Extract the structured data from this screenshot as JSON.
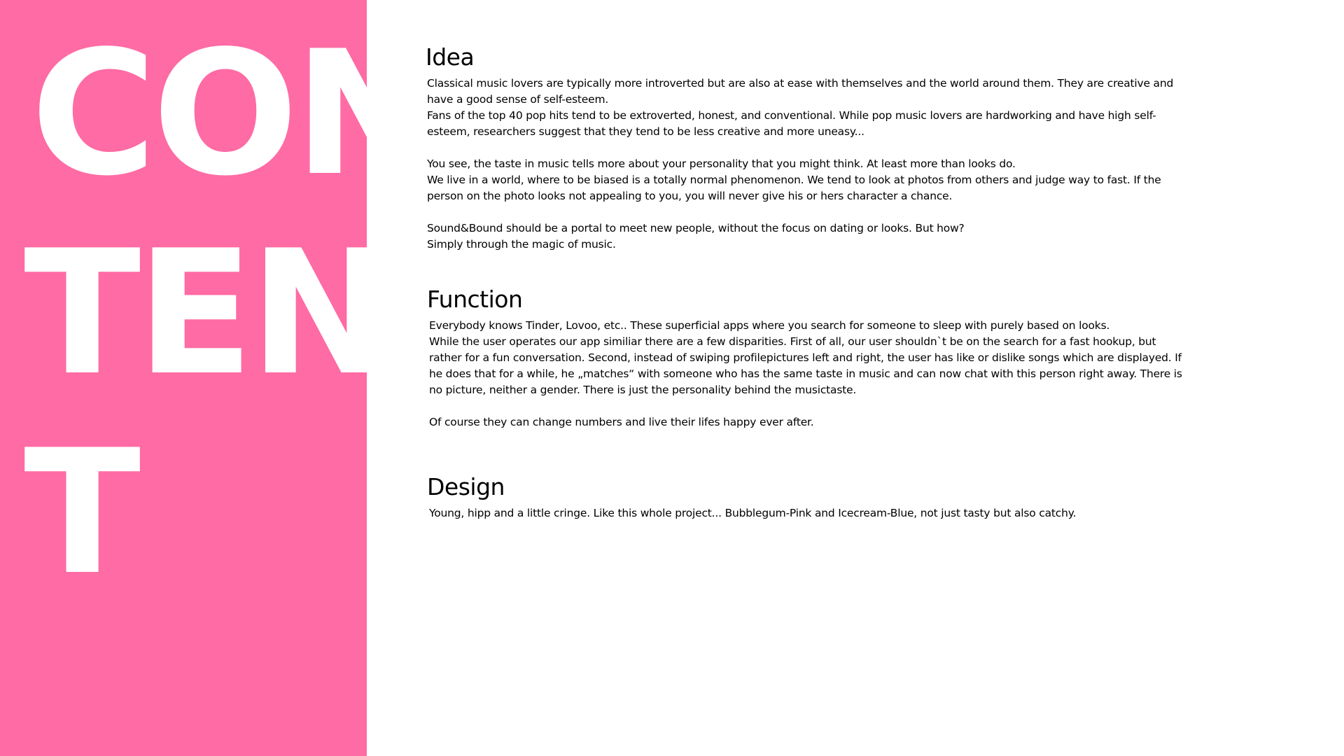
{
  "sidebar": {
    "title_lines": [
      "CON",
      "TEN",
      "T"
    ]
  },
  "sections": {
    "idea": {
      "heading": "Idea",
      "paragraphs": [
        "Classical music lovers are typically more introverted but are also at ease with themselves and the world around them. They are creative and have a good sense of self-esteem.",
        "Fans of the top 40 pop hits tend to be extroverted, honest, and conventional. While pop music lovers are hardworking and have high self-esteem, researchers suggest that they tend to be less creative and more uneasy...",
        "You see, the taste in music tells more about your personality that you might think. At least more than looks do.",
        "We live in a world, where to be biased is a totally normal phenomenon. We tend to look at photos from others and judge way to fast. If the person on the photo looks not appealing to you, you will never give his or hers character a chance.",
        "Sound&Bound should be a portal to meet new people, without the focus on dating or looks. But how?",
        "Simply through the magic of music."
      ]
    },
    "function": {
      "heading": "Function",
      "paragraphs": [
        "Everybody knows Tinder, Lovoo, etc.. These superficial apps where you search for someone to sleep with purely based on looks.",
        "While the user operates our app similiar there are a few disparities. First of all, our user shouldn`t be on the search for a fast hookup, but rather for a fun conversation. Second, instead of swiping profilepictures left and right, the user has like or dislike songs which are displayed. If he does that for a while, he „matches“ with someone who has the same taste in music and can now chat with this person right away. There is no picture, neither a gender. There is just the personality behind the musictaste.",
        "Of course they can change numbers and live their lifes happy ever after."
      ]
    },
    "design": {
      "heading": "Design",
      "paragraphs": [
        "Young, hipp and a little cringe. Like this whole project... Bubblegum-Pink and Icecream-Blue, not just tasty but also catchy."
      ]
    }
  },
  "colors": {
    "accent_pink": "#ff6ba4",
    "text": "#000000",
    "background": "#ffffff"
  }
}
